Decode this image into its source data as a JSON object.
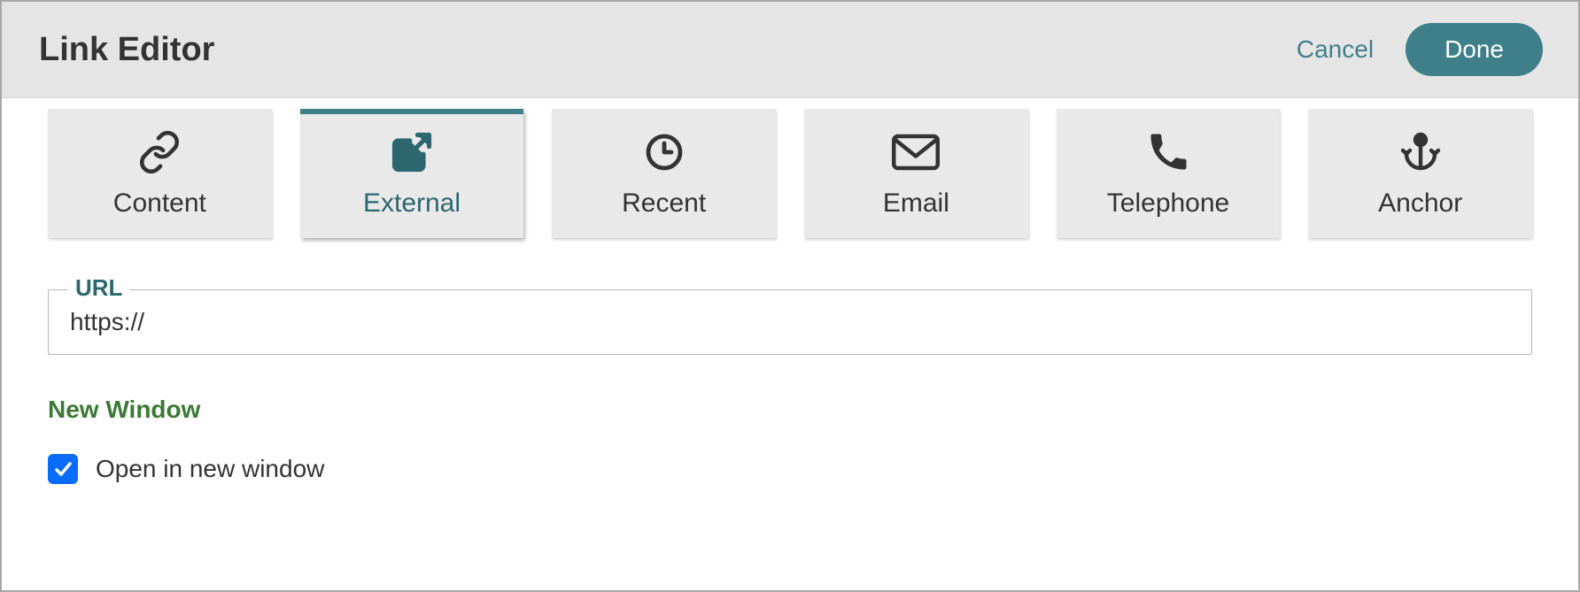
{
  "header": {
    "title": "Link Editor",
    "cancel": "Cancel",
    "done": "Done"
  },
  "tabs": [
    {
      "id": "content",
      "label": "Content",
      "icon": "link-icon",
      "active": false
    },
    {
      "id": "external",
      "label": "External",
      "icon": "external-link-icon",
      "active": true
    },
    {
      "id": "recent",
      "label": "Recent",
      "icon": "clock-icon",
      "active": false
    },
    {
      "id": "email",
      "label": "Email",
      "icon": "envelope-icon",
      "active": false
    },
    {
      "id": "telephone",
      "label": "Telephone",
      "icon": "phone-icon",
      "active": false
    },
    {
      "id": "anchor",
      "label": "Anchor",
      "icon": "anchor-icon",
      "active": false
    }
  ],
  "form": {
    "url_label": "URL",
    "url_value": "https://",
    "new_window_section": "New Window",
    "open_new_window_label": "Open in new window",
    "open_new_window_checked": true
  }
}
